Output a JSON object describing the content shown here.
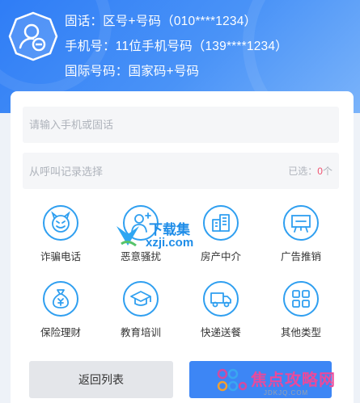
{
  "header": {
    "lines": [
      "固话：区号+号码（010****1234）",
      "手机号：11位手机号码（139****1234）",
      "国际号码：国家码+号码"
    ]
  },
  "form": {
    "phone_placeholder": "请输入手机或固话",
    "history_label": "从呼叫记录选择",
    "selected_prefix": "已选：",
    "selected_count": "0",
    "selected_suffix": "个"
  },
  "categories": [
    {
      "label": "诈骗电话",
      "icon": "devil-face-icon"
    },
    {
      "label": "恶意骚扰",
      "icon": "harass-person-icon"
    },
    {
      "label": "房产中介",
      "icon": "buildings-icon"
    },
    {
      "label": "广告推销",
      "icon": "billboard-icon"
    },
    {
      "label": "保险理财",
      "icon": "money-bag-icon"
    },
    {
      "label": "教育培训",
      "icon": "graduation-cap-icon"
    },
    {
      "label": "快递送餐",
      "icon": "delivery-truck-icon"
    },
    {
      "label": "其他类型",
      "icon": "grid-icon"
    }
  ],
  "buttons": {
    "back": "返回列表",
    "confirm": ""
  },
  "watermarks": {
    "center_title": "下载集",
    "center_url": "xzji.com",
    "corner_title": "焦点攻略网",
    "corner_url": "JDKJQ.COM"
  },
  "colors": {
    "accent": "#2f9ff0",
    "header_blue": "#2f7df6",
    "count_red": "#f0506e"
  }
}
